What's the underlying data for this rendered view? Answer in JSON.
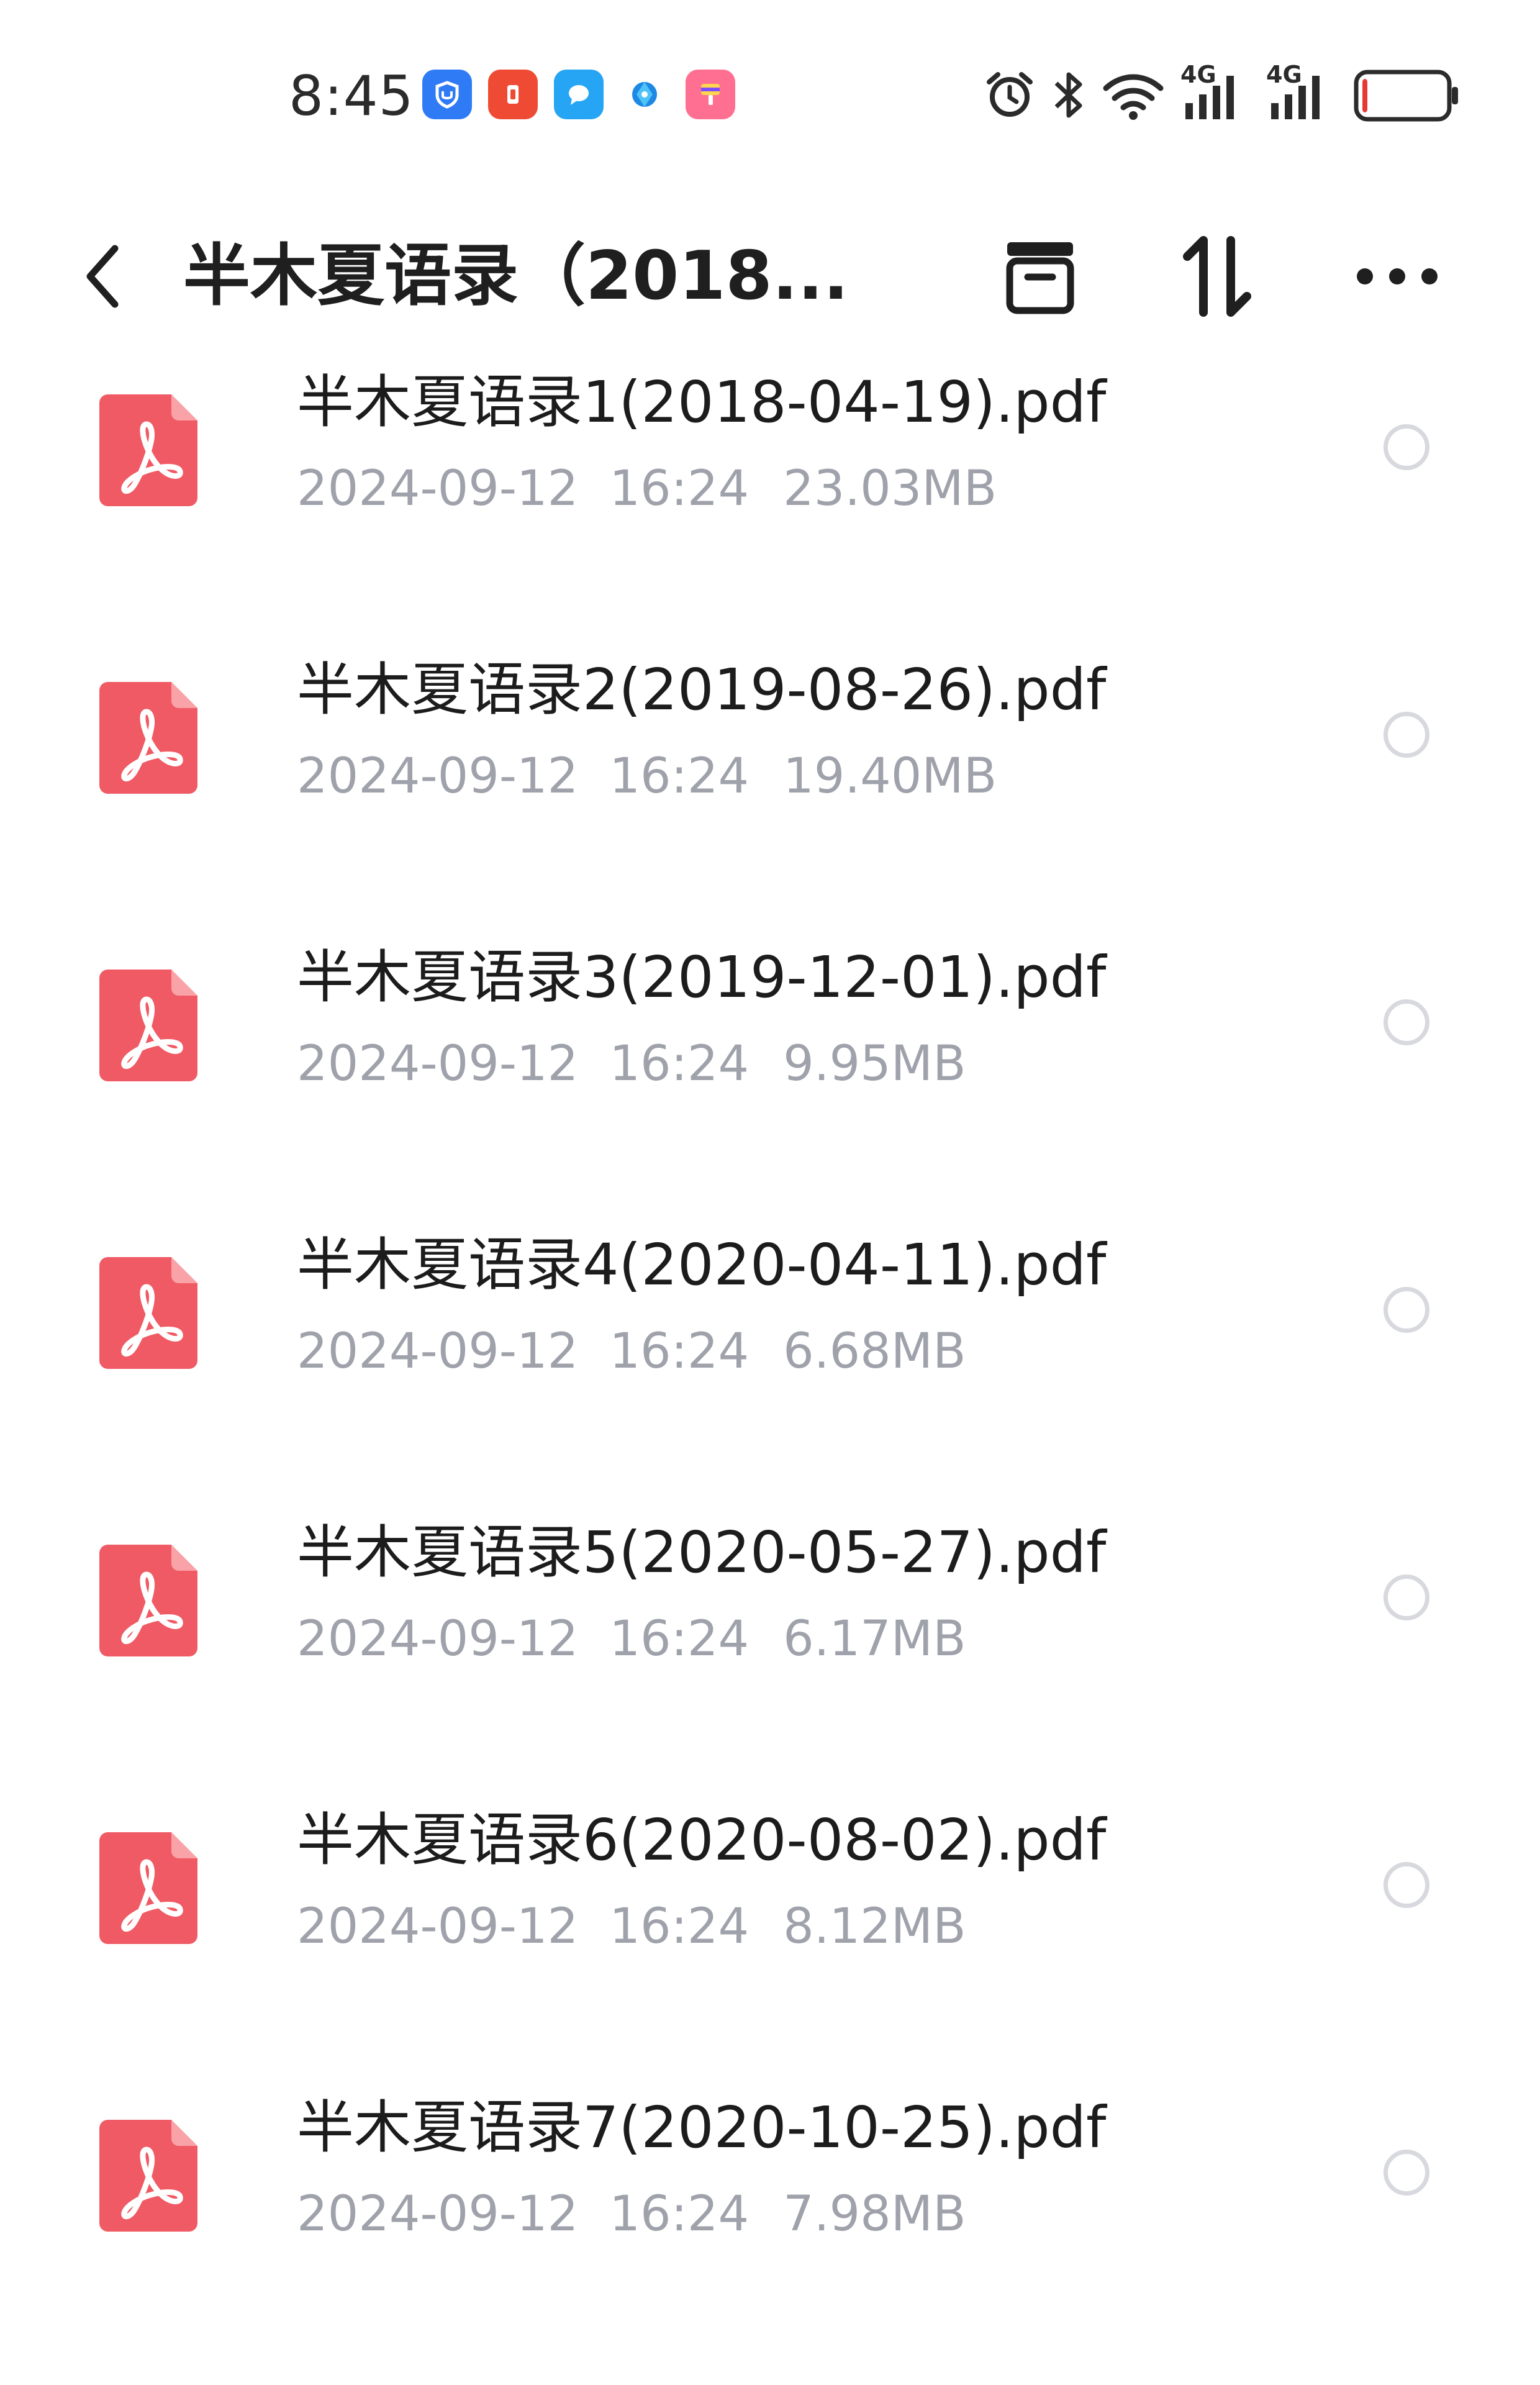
{
  "status_bar": {
    "time": "8:45",
    "notification_icons": [
      "shield-app-icon",
      "red-app-icon",
      "chat-app-icon",
      "browser-app-icon",
      "paint-app-icon"
    ],
    "system_icons": [
      "alarm-icon",
      "bluetooth-icon",
      "wifi-icon",
      "signal-4g-icon",
      "signal-4g-icon"
    ],
    "signal_label": "4G",
    "battery_level": 0.05
  },
  "header": {
    "title": "半木夏语录（2018....",
    "actions": [
      "archive-icon",
      "sort-icon",
      "more-icon"
    ]
  },
  "files": [
    {
      "name": "半木夏语录1(2018-04-19).pdf",
      "date": "2024-09-12",
      "time": "16:24",
      "size": "23.03MB"
    },
    {
      "name": "半木夏语录2(2019-08-26).pdf",
      "date": "2024-09-12",
      "time": "16:24",
      "size": "19.40MB"
    },
    {
      "name": "半木夏语录3(2019-12-01).pdf",
      "date": "2024-09-12",
      "time": "16:24",
      "size": "9.95MB"
    },
    {
      "name": "半木夏语录4(2020-04-11).pdf",
      "date": "2024-09-12",
      "time": "16:24",
      "size": "6.68MB"
    },
    {
      "name": "半木夏语录5(2020-05-27).pdf",
      "date": "2024-09-12",
      "time": "16:24",
      "size": "6.17MB"
    },
    {
      "name": "半木夏语录6(2020-08-02).pdf",
      "date": "2024-09-12",
      "time": "16:24",
      "size": "8.12MB"
    },
    {
      "name": "半木夏语录7(2020-10-25).pdf",
      "date": "2024-09-12",
      "time": "16:24",
      "size": "7.98MB"
    }
  ],
  "colors": {
    "pdf_icon": "#f05a64",
    "meta_text": "#9fa2ab",
    "radio_border": "#d7d9de",
    "battery_low": "#e53935"
  }
}
